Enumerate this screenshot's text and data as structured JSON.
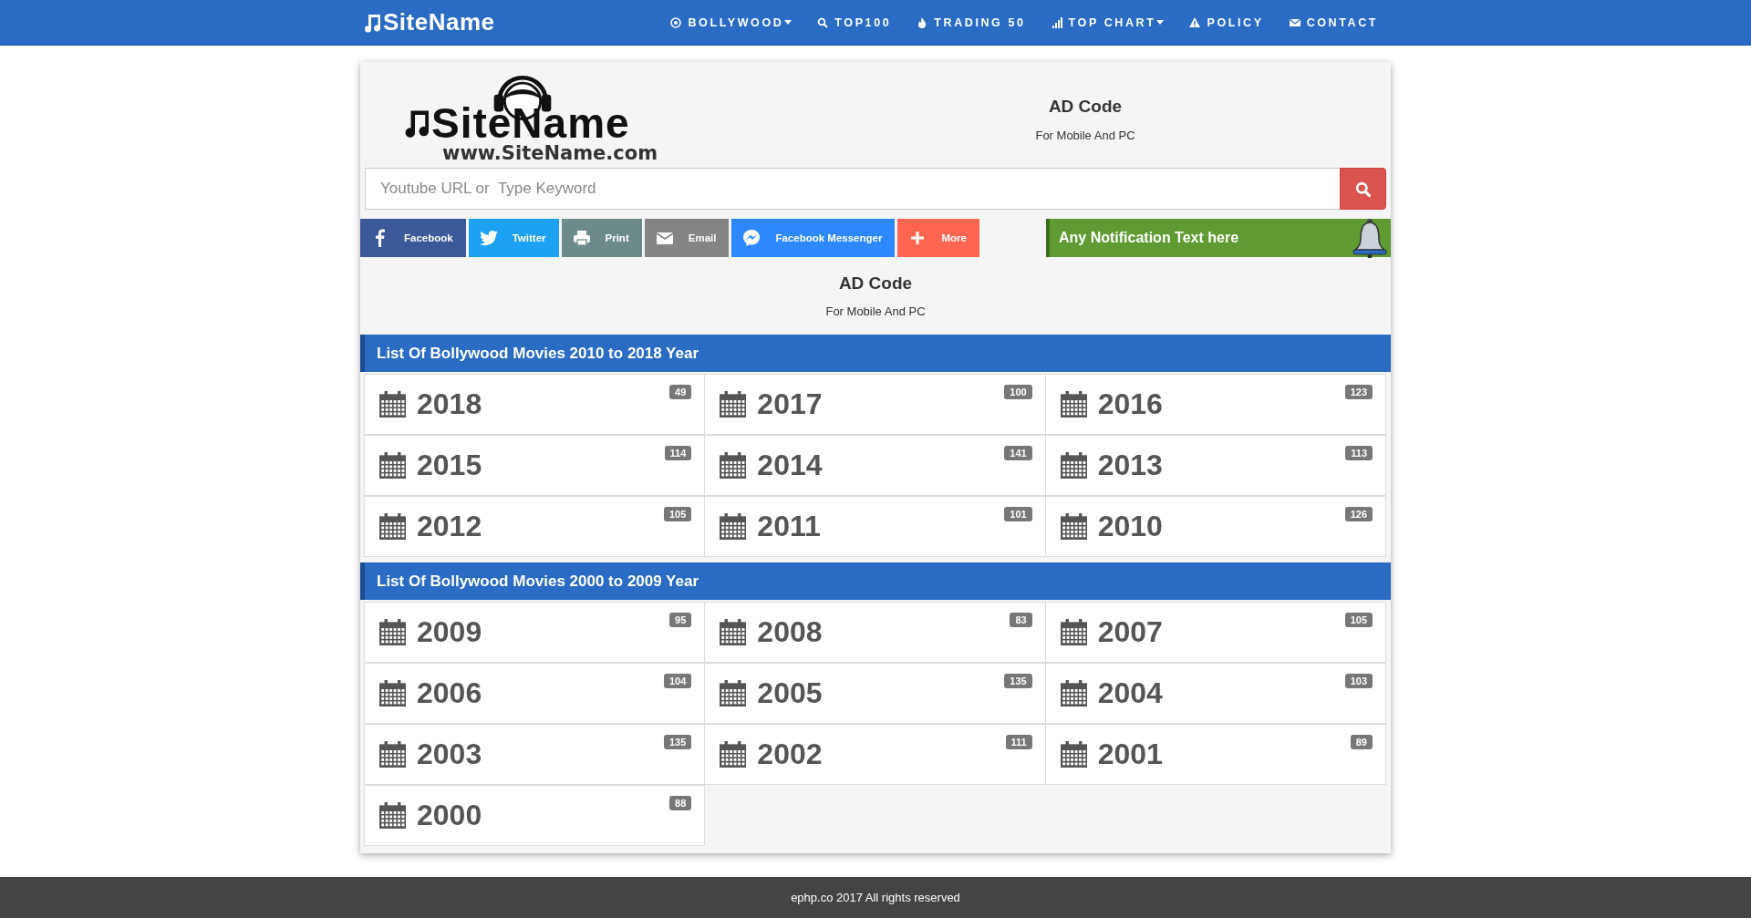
{
  "navbar": {
    "brand": "SiteName",
    "items": [
      {
        "label": "BOLLYWOOD",
        "kind": "disc",
        "dropdown": true
      },
      {
        "label": "TOP100",
        "kind": "search",
        "dropdown": false
      },
      {
        "label": "TRADING 50",
        "kind": "fire",
        "dropdown": false
      },
      {
        "label": "TOP CHART",
        "kind": "signal",
        "dropdown": true
      },
      {
        "label": "POLICY",
        "kind": "warning",
        "dropdown": false
      },
      {
        "label": "CONTACT",
        "kind": "mail",
        "dropdown": false
      }
    ]
  },
  "logo": {
    "name": "SiteName",
    "url": "www.SiteName.com"
  },
  "ad_top": {
    "title": "AD Code",
    "subtitle": "For Mobile And PC"
  },
  "search": {
    "placeholder": "Youtube URL or  Type Keyword"
  },
  "share_buttons": [
    {
      "label": "Facebook",
      "kind": "facebook",
      "color": "#3b5998"
    },
    {
      "label": "Twitter",
      "kind": "twitter",
      "color": "#1da1f2"
    },
    {
      "label": "Print",
      "kind": "print",
      "color": "#6d8a8a"
    },
    {
      "label": "Email",
      "kind": "email",
      "color": "#848484"
    },
    {
      "label": "Facebook Messenger",
      "kind": "messenger",
      "color": "#2d88ff"
    },
    {
      "label": "More",
      "kind": "more",
      "color": "#ff6550"
    }
  ],
  "notification": {
    "text": "Any Notification Text here"
  },
  "ad_middle": {
    "title": "AD Code",
    "subtitle": "For Mobile And PC"
  },
  "sections": [
    {
      "title": "List Of Bollywood Movies 2010 to 2018 Year",
      "years": [
        {
          "year": "2018",
          "count": "49"
        },
        {
          "year": "2017",
          "count": "100"
        },
        {
          "year": "2016",
          "count": "123"
        },
        {
          "year": "2015",
          "count": "114"
        },
        {
          "year": "2014",
          "count": "141"
        },
        {
          "year": "2013",
          "count": "113"
        },
        {
          "year": "2012",
          "count": "105"
        },
        {
          "year": "2011",
          "count": "101"
        },
        {
          "year": "2010",
          "count": "126"
        }
      ]
    },
    {
      "title": "List Of Bollywood Movies 2000 to 2009 Year",
      "years": [
        {
          "year": "2009",
          "count": "95"
        },
        {
          "year": "2008",
          "count": "83"
        },
        {
          "year": "2007",
          "count": "105"
        },
        {
          "year": "2006",
          "count": "104"
        },
        {
          "year": "2005",
          "count": "135"
        },
        {
          "year": "2004",
          "count": "103"
        },
        {
          "year": "2003",
          "count": "135"
        },
        {
          "year": "2002",
          "count": "111"
        },
        {
          "year": "2001",
          "count": "89"
        },
        {
          "year": "2000",
          "count": "88"
        }
      ]
    }
  ],
  "footer": "ephp.co 2017 All rights reserved"
}
